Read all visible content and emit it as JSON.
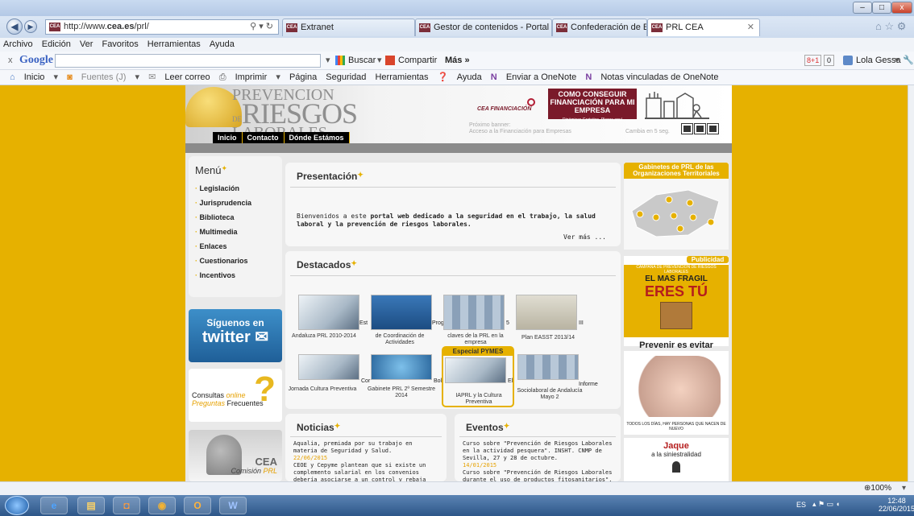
{
  "browser": {
    "url_prefix": "http://www.",
    "url_domain": "cea.es",
    "url_path": "/prl/",
    "search_glyph": "⚲ ▾ ↻",
    "tabs": [
      "Extranet",
      "Gestor de contenidos - Portal ...",
      "Confederación de Empresarios...",
      "PRL CEA"
    ],
    "tab_close": "✕",
    "window_buttons": [
      "–",
      "□",
      "x"
    ],
    "right_icons": "⌂ ☆ ⚙"
  },
  "menubar": [
    "Archivo",
    "Edición",
    "Ver",
    "Favoritos",
    "Herramientas",
    "Ayuda"
  ],
  "google_toolbar": {
    "close": "x",
    "logo": "Google",
    "buscar": "Buscar",
    "compartir": "Compartir",
    "mas": "Más »",
    "plus": "8+1",
    "plus_count": "0",
    "user": "Lola Gessa"
  },
  "cmdbar": [
    "Inicio",
    "Fuentes (J)",
    "Leer correo",
    "Imprimir",
    "Página",
    "Seguridad",
    "Herramientas",
    "Ayuda",
    "Enviar a OneNote",
    "Notas vinculadas de OneNote"
  ],
  "site": {
    "logo_line1": "PREVENCION",
    "logo_line2": "RIESGOS",
    "logo_de": "DE",
    "logo_line3": "LABORALES",
    "nav": [
      "Inicio",
      "Contacto",
      "Dónde Estámos"
    ],
    "cea_fin": "CEA FINANCIACIÓN",
    "ad_title": "COMO CONSEGUIR FINANCIACIÓN PARA MI EMPRESA",
    "ad_sub": "Dinámicas Gratuitas. Plazas aquí",
    "next_banner": "Próximo banner:",
    "next_banner_text": "Acceso a la Financiación para Empresas",
    "change": "Cambia en 5 seg."
  },
  "menu": {
    "title": "Menú",
    "items": [
      "Legislación",
      "Jurisprudencia",
      "Biblioteca",
      "Multimedia",
      "Enlaces",
      "Cuestionarios",
      "Incentivos"
    ]
  },
  "twitter": {
    "line1": "Síguenos en",
    "line2": "twitter"
  },
  "consultas": {
    "online1": "Consultas",
    "online2": "online",
    "preg1": "Preguntas",
    "preg2": "Frecuentes"
  },
  "comision": {
    "cea": "CEA",
    "text1": "Comisión",
    "text2": "PRL"
  },
  "presentacion": {
    "title": "Presentación",
    "text1": "Bienvenidos a este ",
    "text_bold": "portal web dedicado a la seguridad en el trabajo, la salud laboral y la prevención de riesgos laborales.",
    "ver_mas": "Ver más ..."
  },
  "destacados": {
    "title": "Destacados",
    "items": [
      {
        "caption": "Andaluza PRL 2010-2014",
        "side": "Est"
      },
      {
        "caption": "de Coordinación de Actividades",
        "side": "Prog"
      },
      {
        "caption": "claves de la PRL en la empresa",
        "side": "5"
      },
      {
        "caption": "Plan EASST 2013/14",
        "side": "III"
      },
      {
        "caption": "Jornada Cultura Preventiva",
        "side": "Cor"
      },
      {
        "caption": "Gabinete PRL 2º Semestre 2014",
        "side": "Bol"
      },
      {
        "caption": "IAPRL y la Cultura Preventiva",
        "side": "El"
      },
      {
        "caption": "Sociolaboral de Andalucía Mayo 2",
        "side": "Informe"
      }
    ],
    "especial": "Especial PYMES"
  },
  "noticias": {
    "title": "Noticias",
    "items": [
      {
        "text": "Aqualia, premiada por su trabajo en materia de Seguridad y Salud.",
        "date": "22/06/2015"
      },
      {
        "text": "CEOE y Cepyme plantean que si existe un complemento salarial en los convenios debería asociarse a un control y rebaja del absentismo.",
        "date": ""
      }
    ]
  },
  "eventos": {
    "title": "Eventos",
    "items": [
      {
        "text": "Curso sobre \"Prevención de Riesgos Laborales en la actividad pesquera\". INSHT. CNMP de Sevilla, 27 y 28 de octubre.",
        "date": "14/01/2015"
      },
      {
        "text": "Curso sobre \"Prevención de Riesgos Laborales durante el uso de productos fitosanitarios\".",
        "date": ""
      }
    ]
  },
  "right": {
    "gabinetes": "Gabinetes de PRL de las Organizaciones Territoriales",
    "publicidad": "Publicidad",
    "campana": "CAMPAÑA DE PREVENCIÓN DE RIESGOS LABORALES",
    "el_mas": "EL MAS FRAGIL",
    "eres_tu": "ERES TÚ",
    "prevenir": "Prevenir es evitar",
    "todos": "TODOS LOS DÍAS, HAY PERSONAS QUE NACEN DE NUEVO",
    "jaque": "Jaque",
    "siniestralidad": "a la siniestralidad"
  },
  "status": {
    "zoom": "100%"
  },
  "taskbar": {
    "lang": "ES",
    "time": "12:48",
    "date": "22/06/2015"
  }
}
